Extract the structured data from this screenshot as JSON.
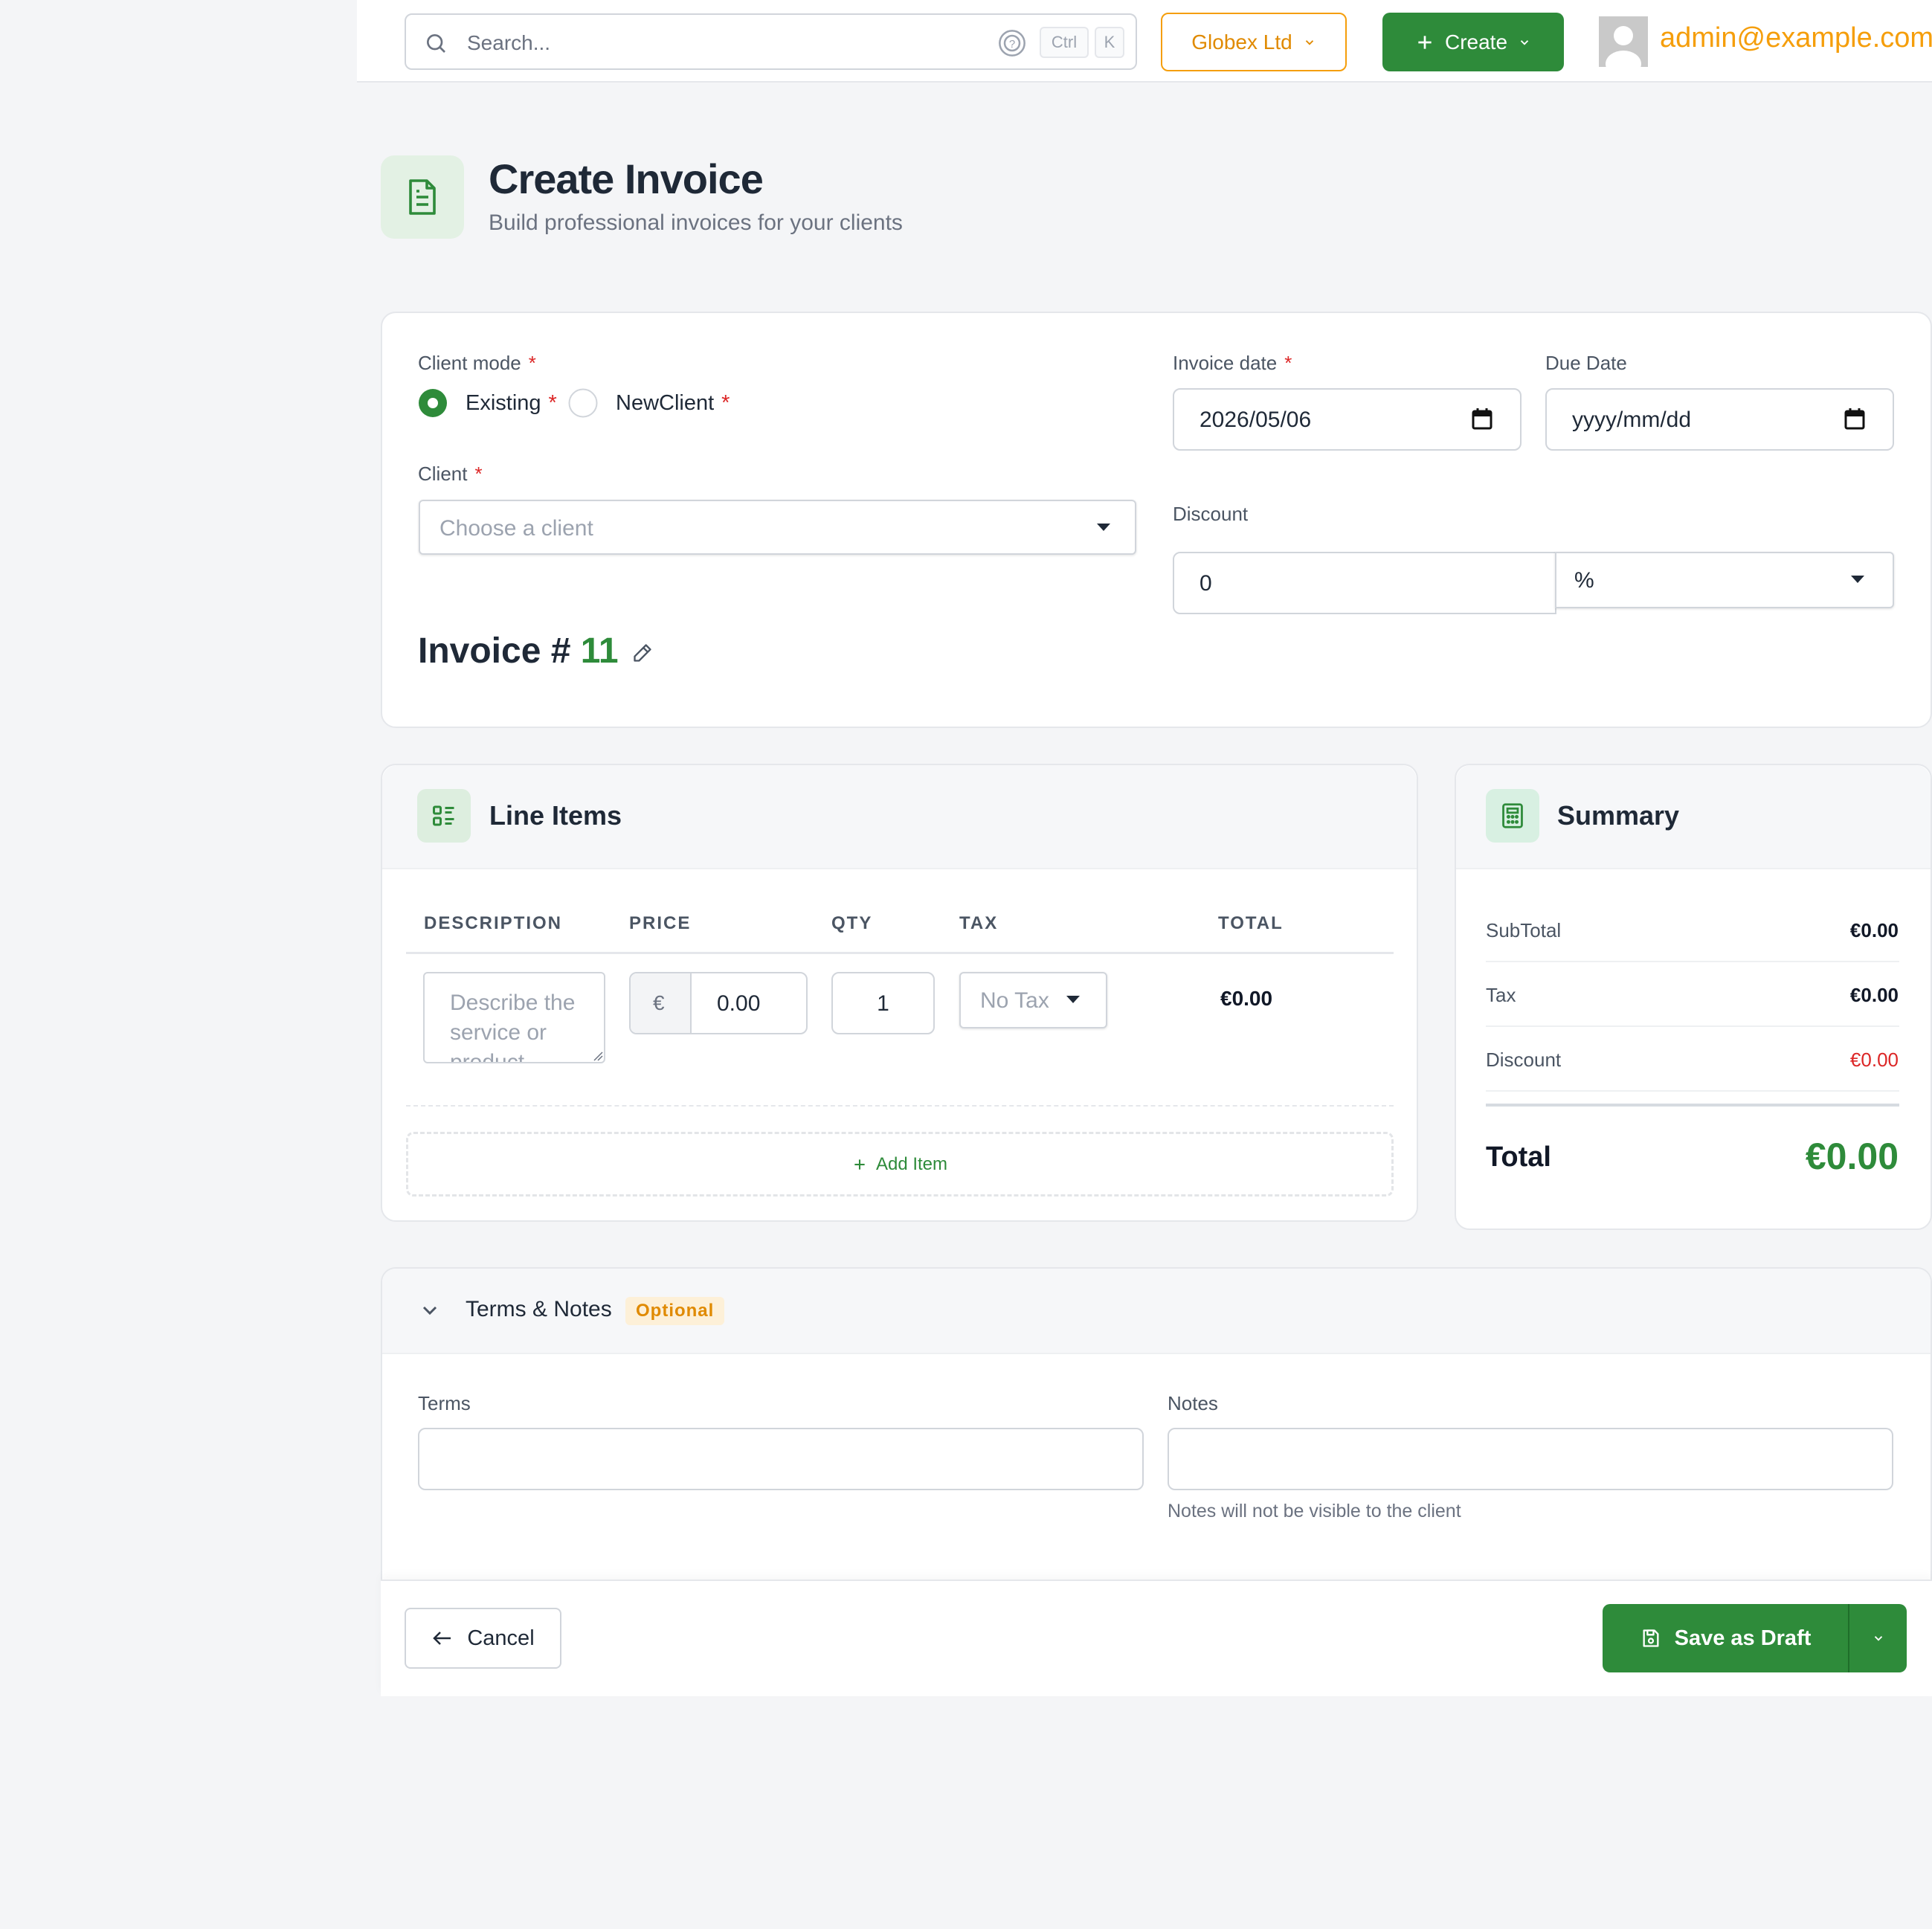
{
  "topbar": {
    "search_placeholder": "Search...",
    "kbd_ctrl": "Ctrl",
    "kbd_k": "K",
    "org_name": "Globex Ltd",
    "create_label": "Create",
    "user_email": "admin@example.com"
  },
  "header": {
    "title": "Create Invoice",
    "subtitle": "Build professional invoices for your clients"
  },
  "form": {
    "client_mode_label": "Client mode",
    "mode_existing": "Existing",
    "mode_new": "NewClient",
    "client_label": "Client",
    "client_placeholder": "Choose a client",
    "invoice_date_label": "Invoice date",
    "invoice_date_value": "2026/05/06",
    "due_date_label": "Due Date",
    "due_date_value": "yyyy/mm/dd",
    "discount_label": "Discount",
    "discount_value": "0",
    "discount_type": "%",
    "invoice_number_prefix": "Invoice #",
    "invoice_number": "11",
    "required_mark": "*"
  },
  "line_items": {
    "title": "Line Items",
    "columns": [
      "DESCRIPTION",
      "PRICE",
      "QTY",
      "TAX",
      "TOTAL"
    ],
    "row": {
      "description_placeholder": "Describe the service or product",
      "currency": "€",
      "price": "0.00",
      "qty": "1",
      "tax": "No Tax",
      "total": "€0.00"
    },
    "add_item_label": "Add Item"
  },
  "summary": {
    "title": "Summary",
    "rows": [
      {
        "label": "SubTotal",
        "value": "€0.00"
      },
      {
        "label": "Tax",
        "value": "€0.00"
      },
      {
        "label": "Discount",
        "value": "€0.00"
      }
    ],
    "total_label": "Total",
    "total_value": "€0.00",
    "accent": "#2e8b3a",
    "discount_color": "#dc2626"
  },
  "terms_notes": {
    "title": "Terms & Notes",
    "badge": "Optional",
    "terms_label": "Terms",
    "notes_label": "Notes",
    "notes_help": "Notes will not be visible to the client"
  },
  "footer": {
    "cancel_label": "Cancel",
    "save_label": "Save as Draft"
  }
}
